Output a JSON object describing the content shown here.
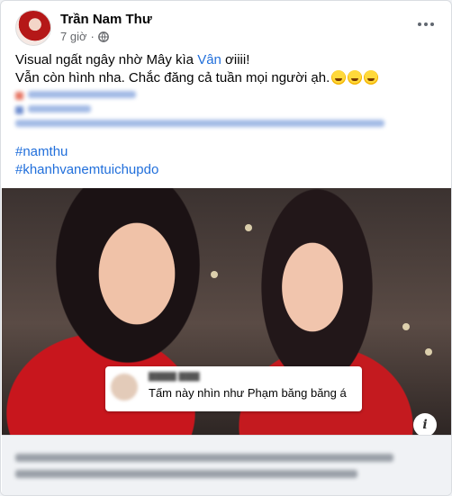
{
  "post": {
    "author": "Trần Nam Thư",
    "time": "7 giờ",
    "separator": "·",
    "text_line1_prefix": "Visual ngất ngây nhờ Mây kìa ",
    "text_line1_link": "Vân",
    "text_line1_suffix": " ơiiii!",
    "text_line2": "Vẫn còn hình nha. Chắc đăng cả tuần mọi người ạh.",
    "emojis": [
      "rolling-on-floor-laughing",
      "rolling-on-floor-laughing",
      "rolling-on-floor-laughing"
    ],
    "hashtags": [
      "#namthu",
      "#khanhvanemtuichupdo"
    ]
  },
  "photo_overlay": {
    "comment_text": "Tấm này nhìn như Phạm băng băng á"
  },
  "icons": {
    "globe": "globe-icon",
    "more": "more-options-icon",
    "info": "info-icon"
  },
  "colors": {
    "link": "#216fdb",
    "secondary_text": "#65676b",
    "dress_red": "#c8161d"
  }
}
